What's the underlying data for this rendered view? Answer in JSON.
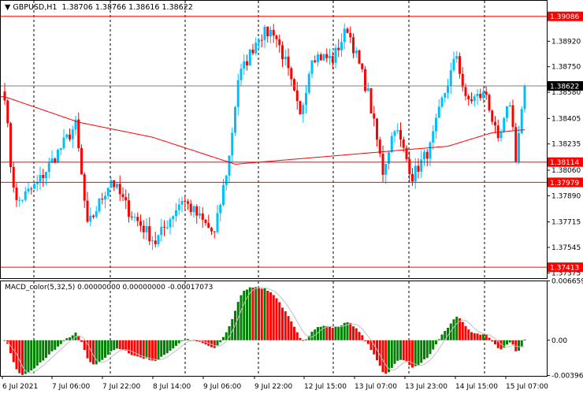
{
  "header": {
    "symbol": "GBPUSD,H1",
    "open": "1.38706",
    "high": "1.38766",
    "low": "1.38616",
    "close": "1.38622"
  },
  "macd_header": {
    "name": "MACD_color(5,32,5)",
    "v1": "0.00000000",
    "v2": "0.00000000",
    "v3": "-0.00017073"
  },
  "colors": {
    "bull": "#00bfff",
    "bear": "#ff0000",
    "ma": "#ff0000",
    "hist_up": "#008000",
    "hist_down": "#ff0000",
    "signal": "#c0c0c0",
    "level": "#ff0000",
    "bid": "#808080"
  },
  "chart_data": {
    "type": "candlestick",
    "symbol": "GBPUSD",
    "timeframe": "H1",
    "ylim": [
      1.3734,
      1.39195
    ],
    "price_ticks": [
      "1.38920",
      "1.38750",
      "1.38580",
      "1.38405",
      "1.38235",
      "1.38060",
      "1.37890",
      "1.37715",
      "1.37545",
      "1.37375"
    ],
    "levels": [
      "1.39086",
      "1.38114",
      "1.37979",
      "1.37413"
    ],
    "bid": "1.38622",
    "close_keypoints": [
      [
        0,
        1.3857
      ],
      [
        2,
        1.381
      ],
      [
        4,
        1.3784
      ],
      [
        11,
        1.3797
      ],
      [
        24,
        1.3836
      ],
      [
        28,
        1.3768
      ],
      [
        36,
        1.38
      ],
      [
        42,
        1.3779
      ],
      [
        51,
        1.3758
      ],
      [
        60,
        1.3787
      ],
      [
        71,
        1.3763
      ],
      [
        76,
        1.3815
      ],
      [
        79,
        1.3867
      ],
      [
        86,
        1.3896
      ],
      [
        91,
        1.3899
      ],
      [
        95,
        1.3878
      ],
      [
        100,
        1.3841
      ],
      [
        104,
        1.3883
      ],
      [
        111,
        1.388
      ],
      [
        116,
        1.3901
      ],
      [
        123,
        1.3857
      ],
      [
        128,
        1.3805
      ],
      [
        132,
        1.3836
      ],
      [
        138,
        1.3802
      ],
      [
        144,
        1.3821
      ],
      [
        148,
        1.3852
      ],
      [
        153,
        1.3883
      ],
      [
        156,
        1.3852
      ],
      [
        163,
        1.3857
      ],
      [
        167,
        1.3823
      ],
      [
        171,
        1.3852
      ],
      [
        173,
        1.3815
      ],
      [
        176,
        1.3862
      ]
    ],
    "ma_keypoints": [
      [
        0,
        1.3855
      ],
      [
        25,
        1.3838
      ],
      [
        50,
        1.3828
      ],
      [
        78,
        1.381
      ],
      [
        90,
        1.3812
      ],
      [
        120,
        1.3817
      ],
      [
        150,
        1.3822
      ],
      [
        165,
        1.3831
      ],
      [
        176,
        1.3833
      ]
    ],
    "macd_ticks": [
      "0.0066599",
      "0.00",
      "-0.003966"
    ],
    "macd_range": [
      -0.004,
      0.0067
    ],
    "x_labels": [
      "6 Jul 2021",
      "7 Jul 06:00",
      "7 Jul 22:00",
      "8 Jul 14:00",
      "9 Jul 06:00",
      "9 Jul 22:00",
      "12 Jul 15:00",
      "13 Jul 07:00",
      "13 Jul 23:00",
      "14 Jul 15:00",
      "15 Jul 07:00"
    ]
  }
}
